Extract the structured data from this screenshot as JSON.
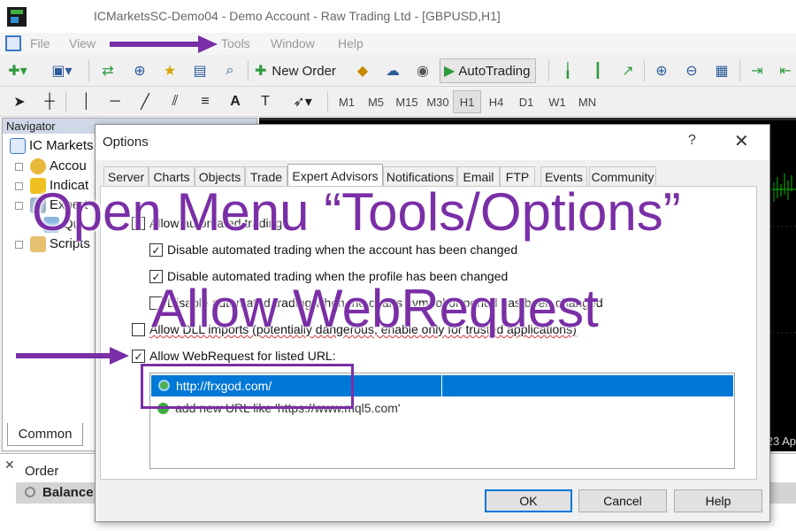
{
  "window": {
    "title": "ICMarketsSC-Demo04 - Demo Account - Raw Trading Ltd - [GBPUSD,H1]"
  },
  "menu": {
    "items": [
      "File",
      "View",
      "Tools",
      "Window",
      "Help"
    ]
  },
  "toolbar": {
    "new_order": "New Order",
    "autotrading": "AutoTrading",
    "text_tool": "A",
    "timeframes": [
      "M1",
      "M5",
      "M15",
      "M30",
      "H1",
      "H4",
      "D1",
      "W1",
      "MN"
    ],
    "active_timeframe": "H1"
  },
  "navigator": {
    "header": "Navigator",
    "items": [
      "IC Markets",
      "Accou",
      "Indicat",
      "Expert",
      "Scripts"
    ],
    "subitem": "Qu",
    "tab": "Common"
  },
  "chart": {
    "date_label": "23 Ap"
  },
  "terminal": {
    "column_order": "Order",
    "balance": "Balance:"
  },
  "dialog": {
    "title": "Options",
    "help_glyph": "?",
    "close_glyph": "✕",
    "tabs": [
      "Server",
      "Charts",
      "Objects",
      "Trade",
      "Expert Advisors",
      "Notifications",
      "Email",
      "FTP",
      "Events",
      "Community"
    ],
    "active_tab": "Expert Advisors",
    "options": [
      {
        "label": "Allow automated trading",
        "checked": true
      },
      {
        "label": "Disable automated trading when the account has been changed",
        "checked": true
      },
      {
        "label": "Disable automated trading when the profile has been changed",
        "checked": true
      },
      {
        "label": "Disable automated trading when the charts symbol or period has been changed",
        "checked": false
      },
      {
        "label": "Allow DLL imports (potentially dangerous, enable only for trusted applications)",
        "checked": false
      },
      {
        "label": "Allow WebRequest for listed URL:",
        "checked": true
      }
    ],
    "urls": [
      "http://frxgod.com/"
    ],
    "add_url_hint": "add new URL like 'https://www.mql5.com'",
    "buttons": {
      "ok": "OK",
      "cancel": "Cancel",
      "help": "Help"
    }
  },
  "overlay": {
    "line1": "Open Menu “Tools/Options”",
    "line2": "Allow WebRequest"
  },
  "colors": {
    "annotation": "#7a2fa6",
    "selection": "#0078d7"
  }
}
